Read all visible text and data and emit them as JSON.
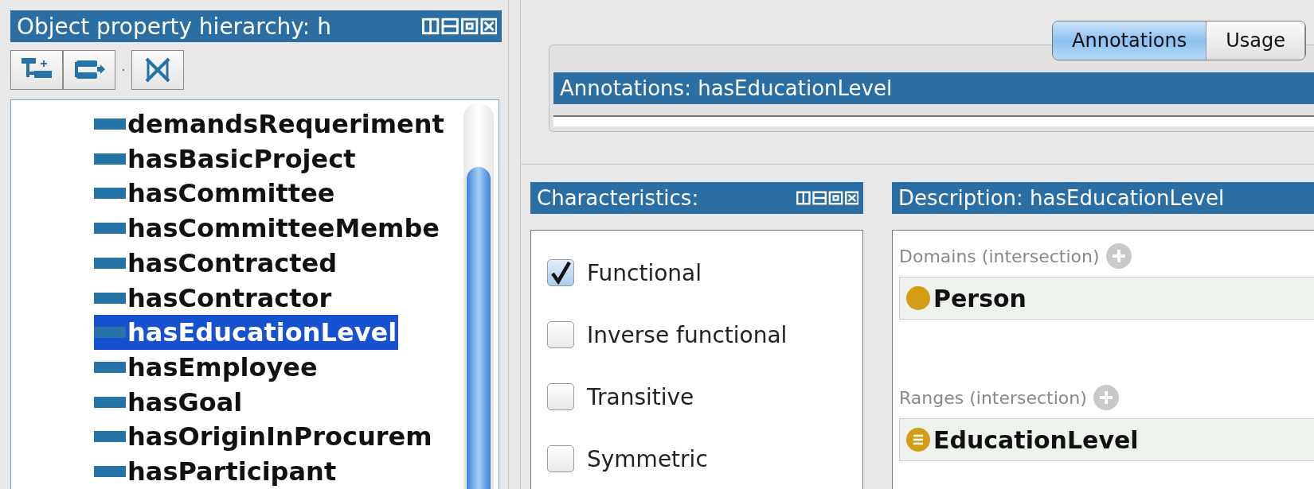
{
  "hierarchy": {
    "title": "Object property hierarchy: h",
    "items": [
      {
        "label": "demandsRequeriment",
        "selected": false
      },
      {
        "label": "hasBasicProject",
        "selected": false
      },
      {
        "label": "hasCommittee",
        "selected": false
      },
      {
        "label": "hasCommitteeMembe",
        "selected": false
      },
      {
        "label": "hasContracted",
        "selected": false
      },
      {
        "label": "hasContractor",
        "selected": false
      },
      {
        "label": "hasEducationLevel",
        "selected": true
      },
      {
        "label": "hasEmployee",
        "selected": false
      },
      {
        "label": "hasGoal",
        "selected": false
      },
      {
        "label": "hasOriginInProcurem",
        "selected": false
      },
      {
        "label": "hasParticipant",
        "selected": false
      }
    ]
  },
  "tabs": [
    {
      "label": "Annotations",
      "selected": true
    },
    {
      "label": "Usage",
      "selected": false
    }
  ],
  "annotations": {
    "title": "Annotations: hasEducationLevel"
  },
  "characteristics": {
    "title": "Characteristics:",
    "items": [
      {
        "label": "Functional",
        "checked": true
      },
      {
        "label": "Inverse functional",
        "checked": false
      },
      {
        "label": "Transitive",
        "checked": false
      },
      {
        "label": "Symmetric",
        "checked": false
      }
    ]
  },
  "description": {
    "title": "Description: hasEducationLevel",
    "sections": [
      {
        "label": "Domains (intersection)",
        "entries": [
          {
            "label": "Person",
            "kind": "class"
          }
        ]
      },
      {
        "label": "Ranges (intersection)",
        "entries": [
          {
            "label": "EducationLevel",
            "kind": "enumeration"
          }
        ]
      }
    ]
  }
}
